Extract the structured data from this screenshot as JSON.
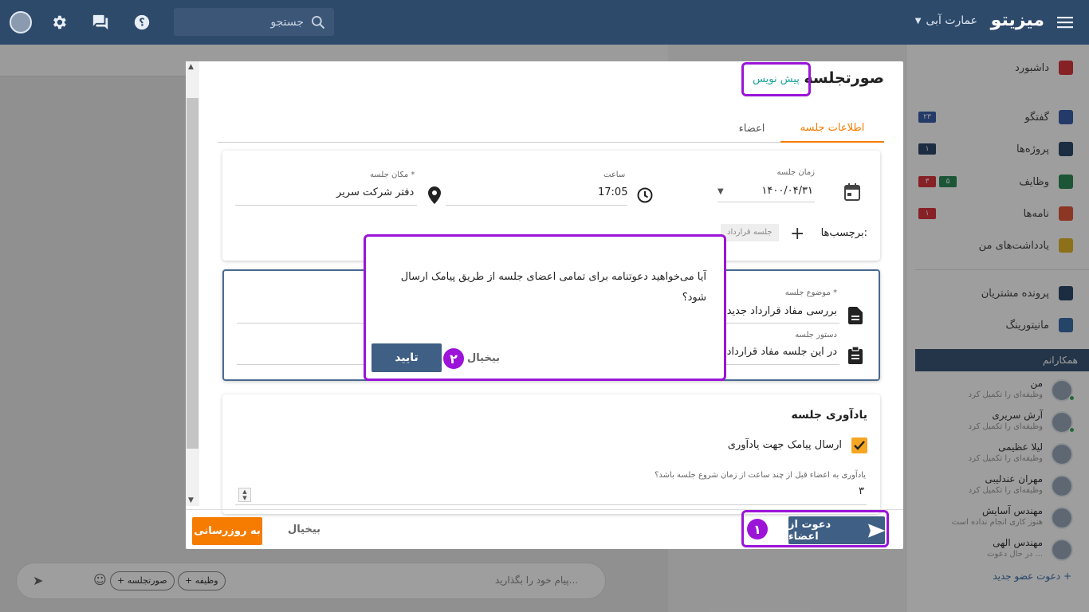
{
  "topbar": {
    "brand": "میزیتو",
    "org": "عمارت آبی",
    "search_placeholder": "جستجو"
  },
  "sidebar": {
    "items": [
      {
        "label": "داشبورد",
        "icon": "home-icon",
        "color": "#d9363e"
      },
      {
        "label": "گفتگو",
        "icon": "chat-icon",
        "color": "#3b5ea8",
        "badge": "۲۳"
      },
      {
        "label": "پروژه‌ها",
        "icon": "projects-icon",
        "color": "#2e4a6b",
        "badge": "۱"
      },
      {
        "label": "وظایف",
        "icon": "check-circle-icon",
        "color": "#2e8b57",
        "badge": "۳",
        "badge2": "۵"
      },
      {
        "label": "نامه‌ها",
        "icon": "mail-icon",
        "color": "#e05a3a",
        "badge": "۱"
      },
      {
        "label": "یادداشت‌های من",
        "icon": "notes-icon",
        "color": "#e2b52b"
      },
      {
        "label": "پرونده مشتریان",
        "icon": "customer-file-icon",
        "color": "#2e4a6b"
      },
      {
        "label": "مانیتورینگ",
        "icon": "monitoring-icon",
        "color": "#3b6ea8"
      }
    ],
    "colleagues_header": "همکارانم",
    "colleagues": [
      {
        "name": "من",
        "status": "وظیفه‌ای را تکمیل کرد"
      },
      {
        "name": "آرش سریری",
        "status": "وظیفه‌ای را تکمیل کرد"
      },
      {
        "name": "لیلا عظیمی",
        "status": "وظیفه‌ای را تکمیل کرد"
      },
      {
        "name": "مهران عندلیبی",
        "status": "وظیفه‌ای را تکمیل کرد"
      },
      {
        "name": "مهندس آسایش",
        "status": "هنوز کاری انجام نداده است"
      },
      {
        "name": "مهندس الهی",
        "status": "در حال دعوت ..."
      }
    ],
    "invite": "دعوت عضو جدید"
  },
  "chat": {
    "message_placeholder": "پیام خود را بگذارید...",
    "chip_minutes": "+ صورتجلسه",
    "chip_task": "+ وظیفه"
  },
  "modal": {
    "title": "صورتجلسه",
    "draft_badge": "پیش نویس",
    "tabs": [
      "اطلاعات جلسه",
      "اعضاء"
    ],
    "meeting_time_label": "زمان جلسه",
    "meeting_time_value": "۱۴۰۰/۰۴/۳۱",
    "hour_label": "ساعت",
    "hour_value": "17:05",
    "place_label": "مکان جلسه *",
    "place_value": "دفتر شرکت سریر",
    "tags_label": "برچسب‌ها:",
    "tag": "جلسه قرارداد",
    "subject_label": "موضوع جلسه *",
    "subject_value": "بررسی مفاد قرارداد جدید",
    "agenda_label": "دستور جلسه",
    "agenda_value": "در این جلسه مفاد قرارداد",
    "reminder_title": "یادآوری جلسه",
    "reminder_checkbox": "ارسال پیامک جهت یادآوری",
    "reminder_hours_label": "یادآوری به اعضاء قبل از چند ساعت از زمان شروع جلسه باشد؟",
    "reminder_hours_value": "۳",
    "invite_button": "دعوت از اعضاء",
    "cancel_button": "بیخیال",
    "update_button": "به روزرسانی",
    "step1": "۱"
  },
  "confirm": {
    "message": "آیا می‌خواهید دعوتنامه برای تمامی اعضای جلسه از طریق پیامک ارسال شود؟",
    "confirm_button": "تایید",
    "cancel_button": "بیخیال",
    "step2": "۲"
  },
  "colors": {
    "topbar": "#2e4a6b",
    "accent_orange": "#f57c00",
    "highlight_purple": "#9b14d8",
    "primary_button": "#3f5f84",
    "draft_teal": "#1aa39a"
  }
}
